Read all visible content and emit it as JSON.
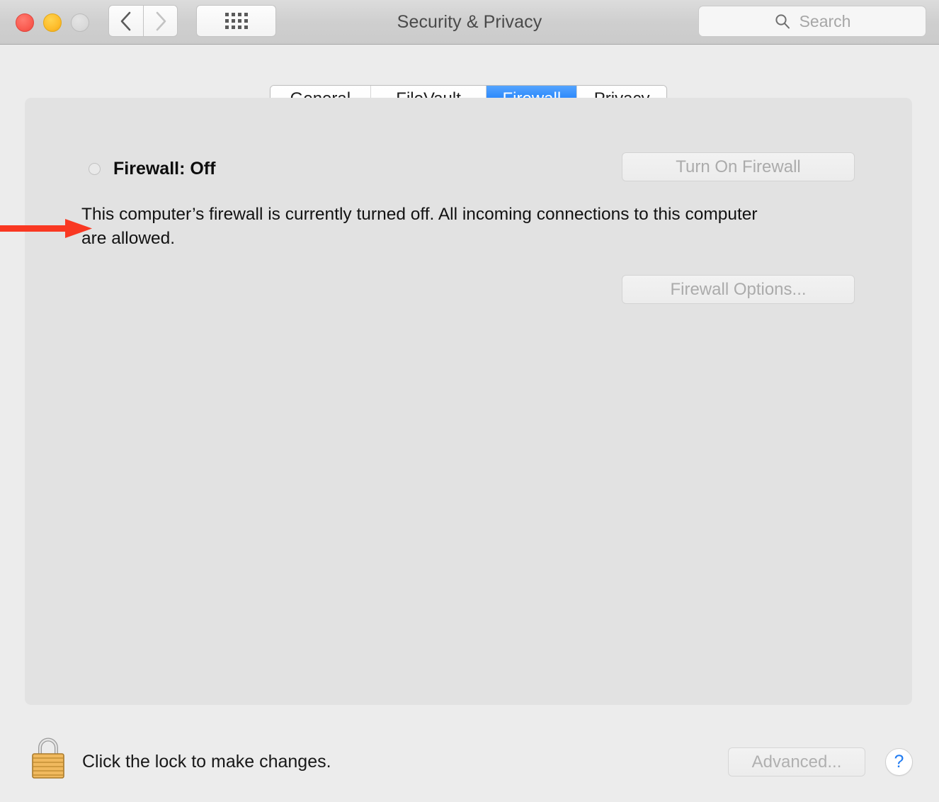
{
  "window": {
    "title": "Security & Privacy",
    "traffic_lights": [
      "close",
      "minimize",
      "zoom"
    ]
  },
  "toolbar": {
    "back_icon": "chevron-left-icon",
    "forward_icon": "chevron-right-icon",
    "grid_icon": "show-all-grid-icon",
    "search": {
      "placeholder": "Search",
      "value": "",
      "icon": "search-icon"
    }
  },
  "tabs": [
    {
      "label": "General",
      "selected": false
    },
    {
      "label": "FileVault",
      "selected": false
    },
    {
      "label": "Firewall",
      "selected": true
    },
    {
      "label": "Privacy",
      "selected": false
    }
  ],
  "firewall": {
    "status_label": "Firewall: Off",
    "status_indicator": "radio-off",
    "description": "This computer’s firewall is currently turned off. All incoming connections to this computer are allowed.",
    "turn_on_button": "Turn On Firewall",
    "options_button": "Firewall Options...",
    "turn_on_enabled": false,
    "options_enabled": false
  },
  "annotation": {
    "type": "red-arrow",
    "color": "#f93822",
    "points_at": "firewall-status-radio"
  },
  "footer": {
    "lock_icon": "padlock-closed-icon",
    "lock_text": "Click the lock to make changes.",
    "advanced_button": "Advanced...",
    "advanced_enabled": false,
    "help_button": "?"
  },
  "colors": {
    "accent_blue": "#2b88fb",
    "window_bg": "#ececec",
    "panel_bg": "#e2e2e2",
    "titlebar_bg": "#cfcfcf",
    "disabled_text": "#ababab",
    "help_blue": "#1f7bf2",
    "annotation_red": "#f93822"
  }
}
